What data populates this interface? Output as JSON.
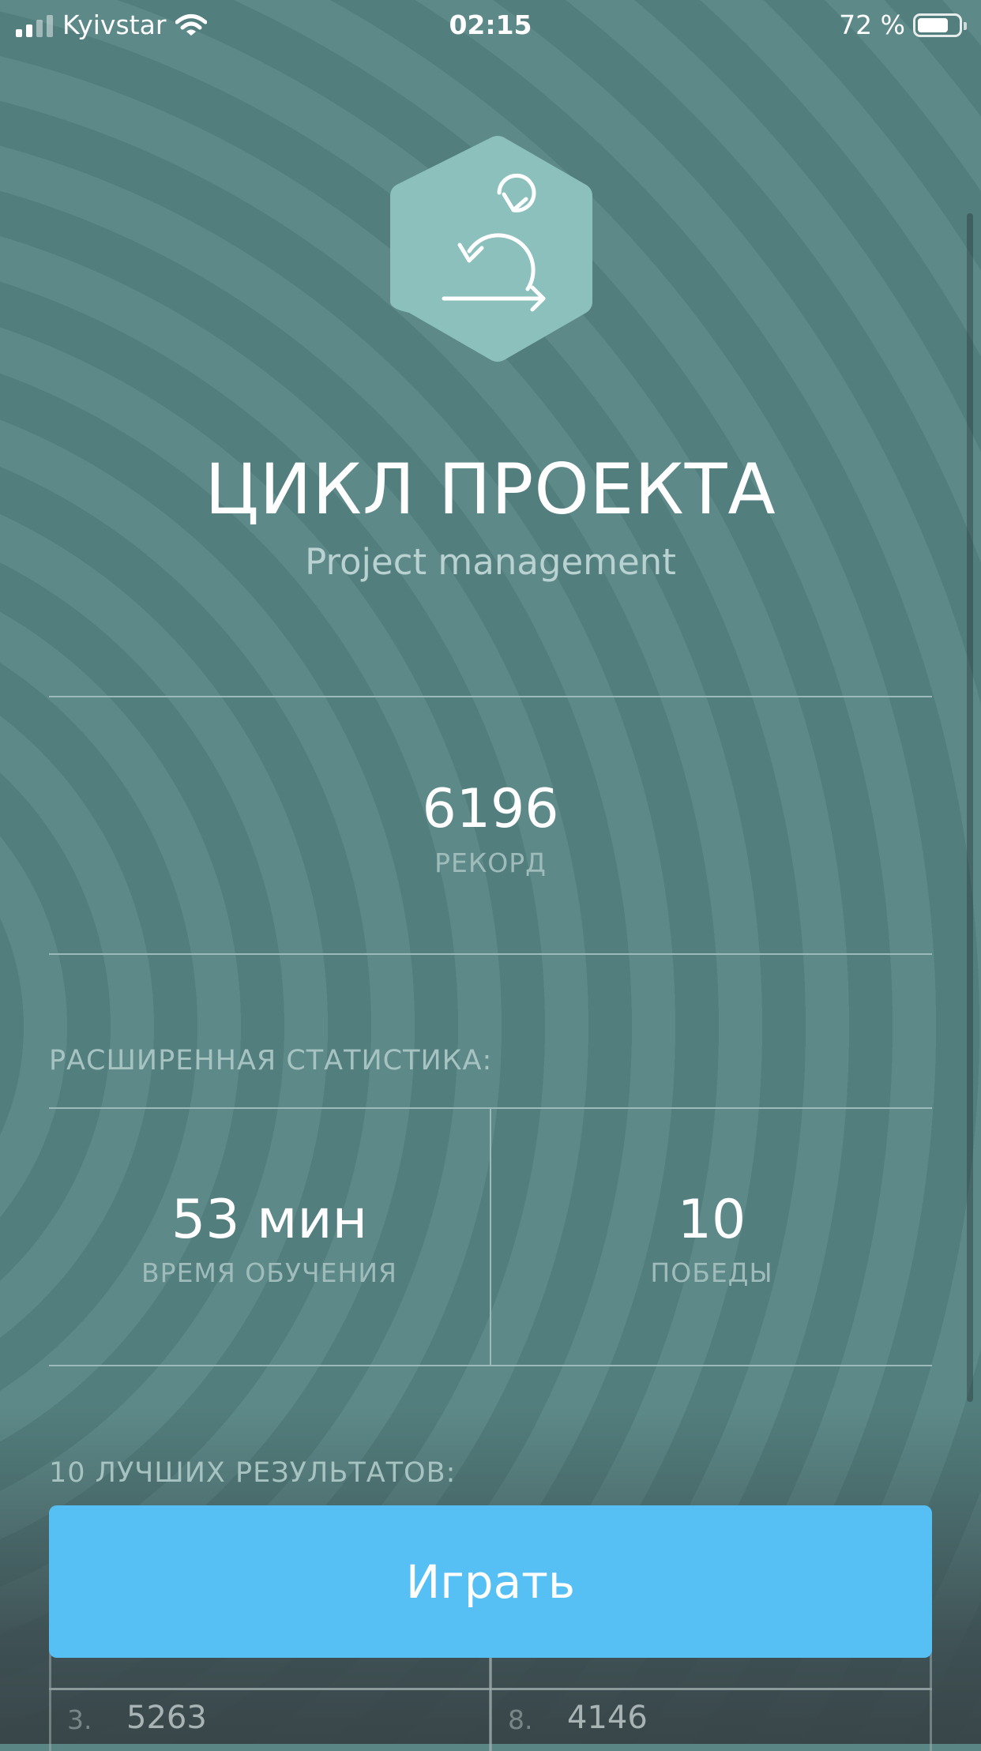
{
  "status_bar": {
    "carrier": "Kyivstar",
    "time": "02:15",
    "battery": "72 %"
  },
  "course": {
    "icon": "project-cycle-icon",
    "title": "ЦИКЛ ПРОЕКТА",
    "subtitle": "Project management"
  },
  "record": {
    "value": "6196",
    "label": "РЕКОРД"
  },
  "extended_stats": {
    "heading": "РАСШИРЕННАЯ СТАТИСТИКА:",
    "learning_time": {
      "value": "53 мин",
      "label": "ВРЕМЯ ОБУЧЕНИЯ"
    },
    "wins": {
      "value": "10",
      "label": "ПОБЕДЫ"
    }
  },
  "top_results": {
    "heading": "10 ЛУЧШИХ РЕЗУЛЬТАТОВ:",
    "rows": [
      {
        "left": {
          "rank": "3.",
          "value": "5263"
        },
        "right": {
          "rank": "8.",
          "value": "4146"
        }
      }
    ]
  },
  "play_button": {
    "label": "Играть"
  },
  "colors": {
    "background": "#5a8786",
    "hexagon": "#8bc0bc",
    "button": "#56bff4",
    "divider": "#9cbab9"
  }
}
